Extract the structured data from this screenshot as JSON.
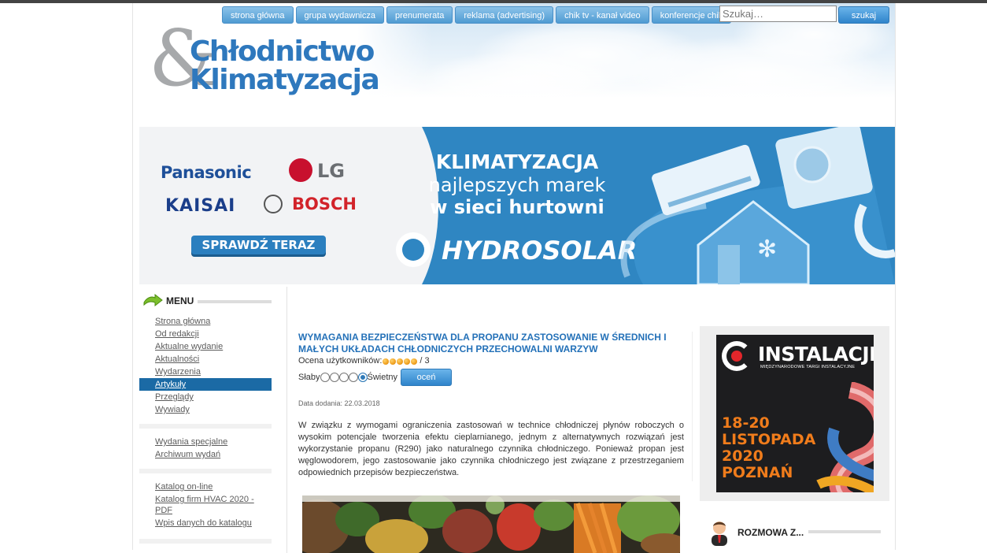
{
  "nav": {
    "items": [
      "strona główna",
      "grupa wydawnicza",
      "prenumerata",
      "reklama (advertising)",
      "chik tv - kanał video",
      "konferencje chik"
    ],
    "search_placeholder": "Szukaj…",
    "search_button": "szukaj"
  },
  "logo": {
    "amp": "&",
    "line1": "Chłodnictwo",
    "line2": "Klimatyzacja"
  },
  "banner": {
    "brands": {
      "panasonic": "Panasonic",
      "lg": "LG",
      "kaisai": "KAISAI",
      "bosch": "BOSCH"
    },
    "cta": "SPRAWDŹ TERAZ",
    "headline1": "KLIMATYZACJA",
    "headline2": "najlepszych marek",
    "headline3": "w sieci hurtowni",
    "company": "HYDROSOLAR"
  },
  "sidebar": {
    "menu_title": "MENU",
    "groups": [
      [
        "Strona główna",
        "Od redakcji",
        "Aktualne wydanie",
        "Aktualności",
        "Wydarzenia",
        "Artykuły",
        "Przeglądy",
        "Wywiady"
      ],
      [
        "Wydania specjalne",
        "Archiwum wydań"
      ],
      [
        "Katalog on-line",
        "Katalog firm HVAC 2020 - PDF",
        "Wpis danych do katalogu"
      ]
    ],
    "active_item": "Artykuły"
  },
  "article": {
    "title": "WYMAGANIA BEZPIECZEŃSTWA DLA PROPANU ZASTOSOWANIE W ŚREDNICH I MAŁYCH UKŁADACH CHŁODNICZYCH PRZECHOWALNI WARZYW",
    "rating_label": "Ocena użytkowników:",
    "rating_stars": 5,
    "rating_suffix": "/ 3",
    "scale_low": "Słaby",
    "scale_high": "Świetny",
    "selected_radio": 5,
    "rate_button": "oceń",
    "date_label": "Data dodania: 22.03.2018",
    "body": "W związku z wymogami ograniczenia zastosowań w technice chłodniczej płynów roboczych o wysokim potencjale tworzenia efektu cieplarnianego, jednym z alternatywnych rozwiązań jest wykorzystanie propanu (R290) jako naturalnego czynnika chłodniczego. Ponieważ propan jest węglowodorem, jego zastosowanie jako czynnika chłodniczego jest związane z przestrzeganiem odpowiednich przepisów bezpieczeństwa."
  },
  "right_ad": {
    "title": "INSTALACJE",
    "subtitle": "MIĘDZYNARODOWE TARGI INSTALACYJNE",
    "date_lines": [
      "18-20",
      "LISTOPADA",
      "2020",
      "POZNAŃ"
    ]
  },
  "rozmowa": {
    "title": "ROZMOWA Z..."
  }
}
